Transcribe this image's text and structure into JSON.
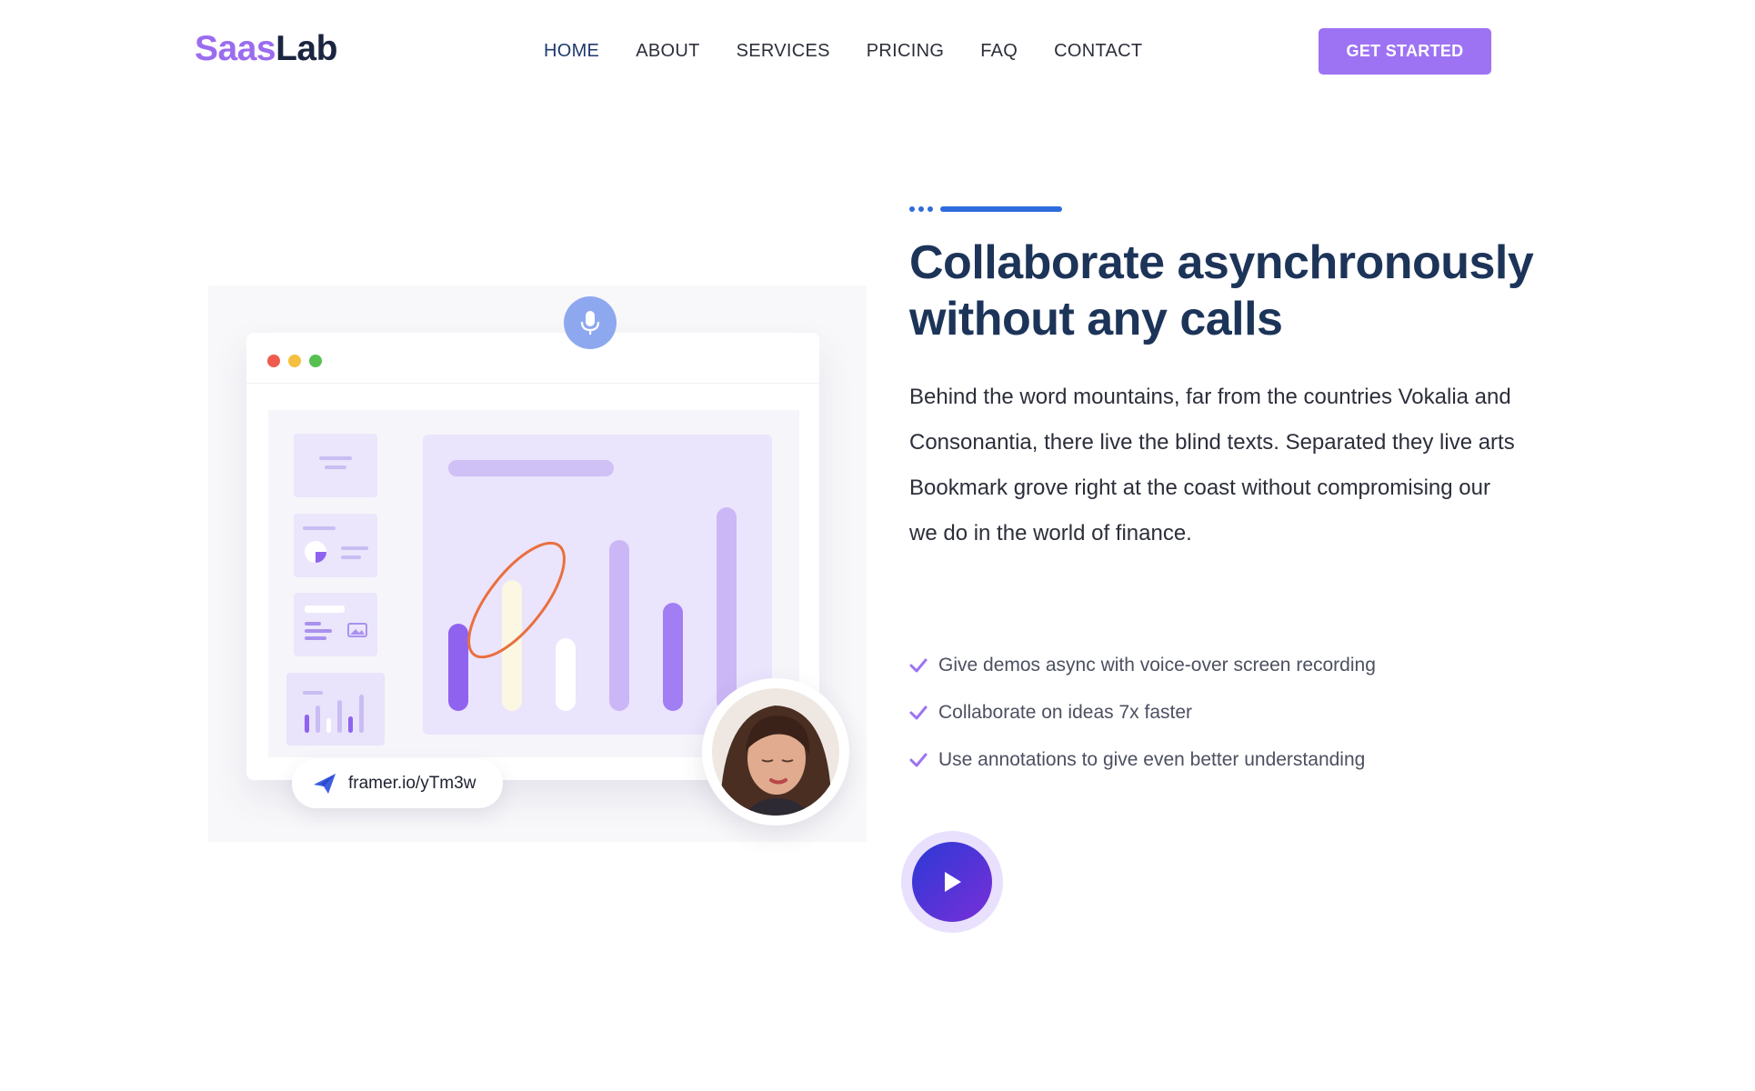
{
  "logo": {
    "part1": "Saas",
    "part2": "Lab"
  },
  "nav": {
    "items": [
      {
        "label": "HOME"
      },
      {
        "label": "ABOUT"
      },
      {
        "label": "SERVICES"
      },
      {
        "label": "PRICING"
      },
      {
        "label": "FAQ"
      },
      {
        "label": "CONTACT"
      }
    ]
  },
  "header": {
    "cta_label": "GET STARTED"
  },
  "illustration": {
    "link_text": "framer.io/yTm3w",
    "icons": [
      "microphone-icon",
      "send-icon",
      "avatar-photo"
    ]
  },
  "content": {
    "headline": "Collaborate asynchronously without any calls",
    "body": "Behind the word mountains, far from the countries Vokalia and Consonantia, there live the blind texts. Separated they live arts Bookmark grove right at the coast without compromising our",
    "body_line2": "we do in the world of finance.",
    "features": [
      "Give demos async with voice-over screen recording",
      "Collaborate on ideas 7x faster",
      "Use annotations to give even better understanding"
    ]
  },
  "colors": {
    "brand_purple": "#9d73f3",
    "heading_navy": "#1d3459",
    "accent_blue": "#2f6bdc",
    "play_gradient": [
      "#2b39d6",
      "#7a2fd8"
    ]
  }
}
